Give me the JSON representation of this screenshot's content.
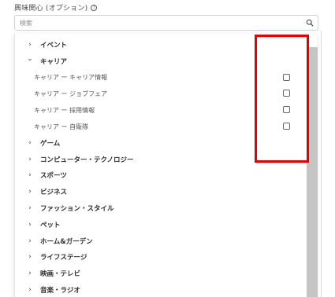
{
  "field": {
    "label": "興味関心 (オプション)",
    "info_icon": "info-icon"
  },
  "search": {
    "placeholder": "検索",
    "value": "",
    "icon": "search-icon"
  },
  "dropdown": {
    "items": [
      {
        "kind": "category",
        "label": "イベント",
        "expanded": false
      },
      {
        "kind": "category",
        "label": "キャリア",
        "expanded": true
      },
      {
        "kind": "option",
        "label": "キャリア ー キャリア情報",
        "checked": false
      },
      {
        "kind": "option",
        "label": "キャリア ー ジョブフェア",
        "checked": false
      },
      {
        "kind": "option",
        "label": "キャリア ー 採用情報",
        "checked": false
      },
      {
        "kind": "option",
        "label": "キャリア ー 自衛隊",
        "checked": false
      },
      {
        "kind": "category",
        "label": "ゲーム",
        "expanded": false
      },
      {
        "kind": "category",
        "label": "コンピューター・テクノロジー",
        "expanded": false
      },
      {
        "kind": "category",
        "label": "スポーツ",
        "expanded": false
      },
      {
        "kind": "category",
        "label": "ビジネス",
        "expanded": false
      },
      {
        "kind": "category",
        "label": "ファッション・スタイル",
        "expanded": false
      },
      {
        "kind": "category",
        "label": "ペット",
        "expanded": false
      },
      {
        "kind": "category",
        "label": "ホーム&ガーデン",
        "expanded": false
      },
      {
        "kind": "category",
        "label": "ライフステージ",
        "expanded": false
      },
      {
        "kind": "category",
        "label": "映画・テレビ",
        "expanded": false
      },
      {
        "kind": "category",
        "label": "音楽・ラジオ",
        "expanded": false
      }
    ]
  },
  "annotation": {
    "color": "#e60000"
  }
}
